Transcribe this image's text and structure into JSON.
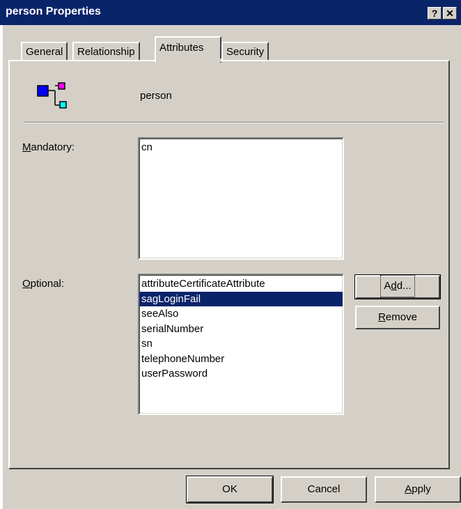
{
  "window": {
    "title": "person Properties",
    "help_glyph": "?",
    "close_glyph": "✕"
  },
  "tabs": [
    {
      "label": "General"
    },
    {
      "label": "Relationship"
    },
    {
      "label": "Attributes",
      "active": true
    },
    {
      "label": "Security"
    }
  ],
  "class": {
    "name": "person",
    "icon": "class-schema-icon"
  },
  "mandatory": {
    "label_first": "M",
    "label_rest": "andatory:",
    "items": [
      "cn"
    ]
  },
  "optional": {
    "label_first": "O",
    "label_rest": "ptional:",
    "items": [
      "attributeCertificateAttribute",
      "sagLoginFail",
      "seeAlso",
      "serialNumber",
      "sn",
      "telephoneNumber",
      "userPassword"
    ],
    "selected_index": 1
  },
  "buttons": {
    "add": {
      "pre": "A",
      "ul": "d",
      "post": "d..."
    },
    "remove": {
      "ul": "R",
      "post": "emove"
    },
    "ok": "OK",
    "cancel": "Cancel",
    "apply": {
      "ul": "A",
      "post": "pply"
    }
  },
  "colors": {
    "face": "#d4d0c8",
    "titlebar": "#0a246a",
    "selection": "#0a246a"
  }
}
